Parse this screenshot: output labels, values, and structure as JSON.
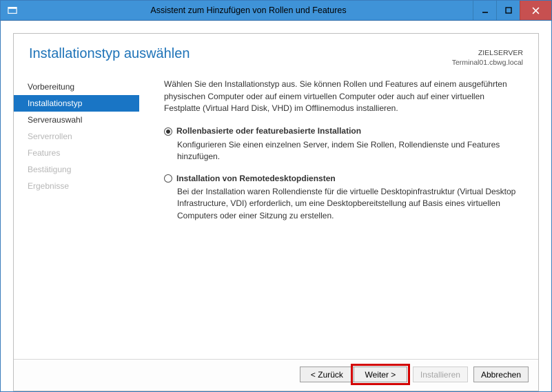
{
  "window": {
    "title": "Assistent zum Hinzufügen von Rollen und Features"
  },
  "header": {
    "page_title": "Installationstyp auswählen",
    "target_label": "ZIELSERVER",
    "target_value": "Terminal01.cbwg.local"
  },
  "nav": {
    "items": [
      {
        "label": "Vorbereitung",
        "state": "normal"
      },
      {
        "label": "Installationstyp",
        "state": "selected"
      },
      {
        "label": "Serverauswahl",
        "state": "normal"
      },
      {
        "label": "Serverrollen",
        "state": "disabled"
      },
      {
        "label": "Features",
        "state": "disabled"
      },
      {
        "label": "Bestätigung",
        "state": "disabled"
      },
      {
        "label": "Ergebnisse",
        "state": "disabled"
      }
    ]
  },
  "content": {
    "intro": "Wählen Sie den Installationstyp aus. Sie können Rollen und Features auf einem ausgeführten physischen Computer oder auf einem virtuellen Computer oder auch auf einer virtuellen Festplatte (Virtual Hard Disk, VHD) im Offlinemodus installieren.",
    "options": [
      {
        "checked": true,
        "title": "Rollenbasierte oder featurebasierte Installation",
        "desc": "Konfigurieren Sie einen einzelnen Server, indem Sie Rollen, Rollendienste und Features hinzufügen."
      },
      {
        "checked": false,
        "title": "Installation von Remotedesktopdiensten",
        "desc": "Bei der Installation waren Rollendienste für die virtuelle Desktopinfrastruktur (Virtual Desktop Infrastructure, VDI) erforderlich, um eine Desktopbereitstellung auf Basis eines virtuellen Computers oder einer Sitzung zu erstellen."
      }
    ]
  },
  "footer": {
    "back": "< Zurück",
    "next": "Weiter >",
    "install": "Installieren",
    "cancel": "Abbrechen"
  }
}
